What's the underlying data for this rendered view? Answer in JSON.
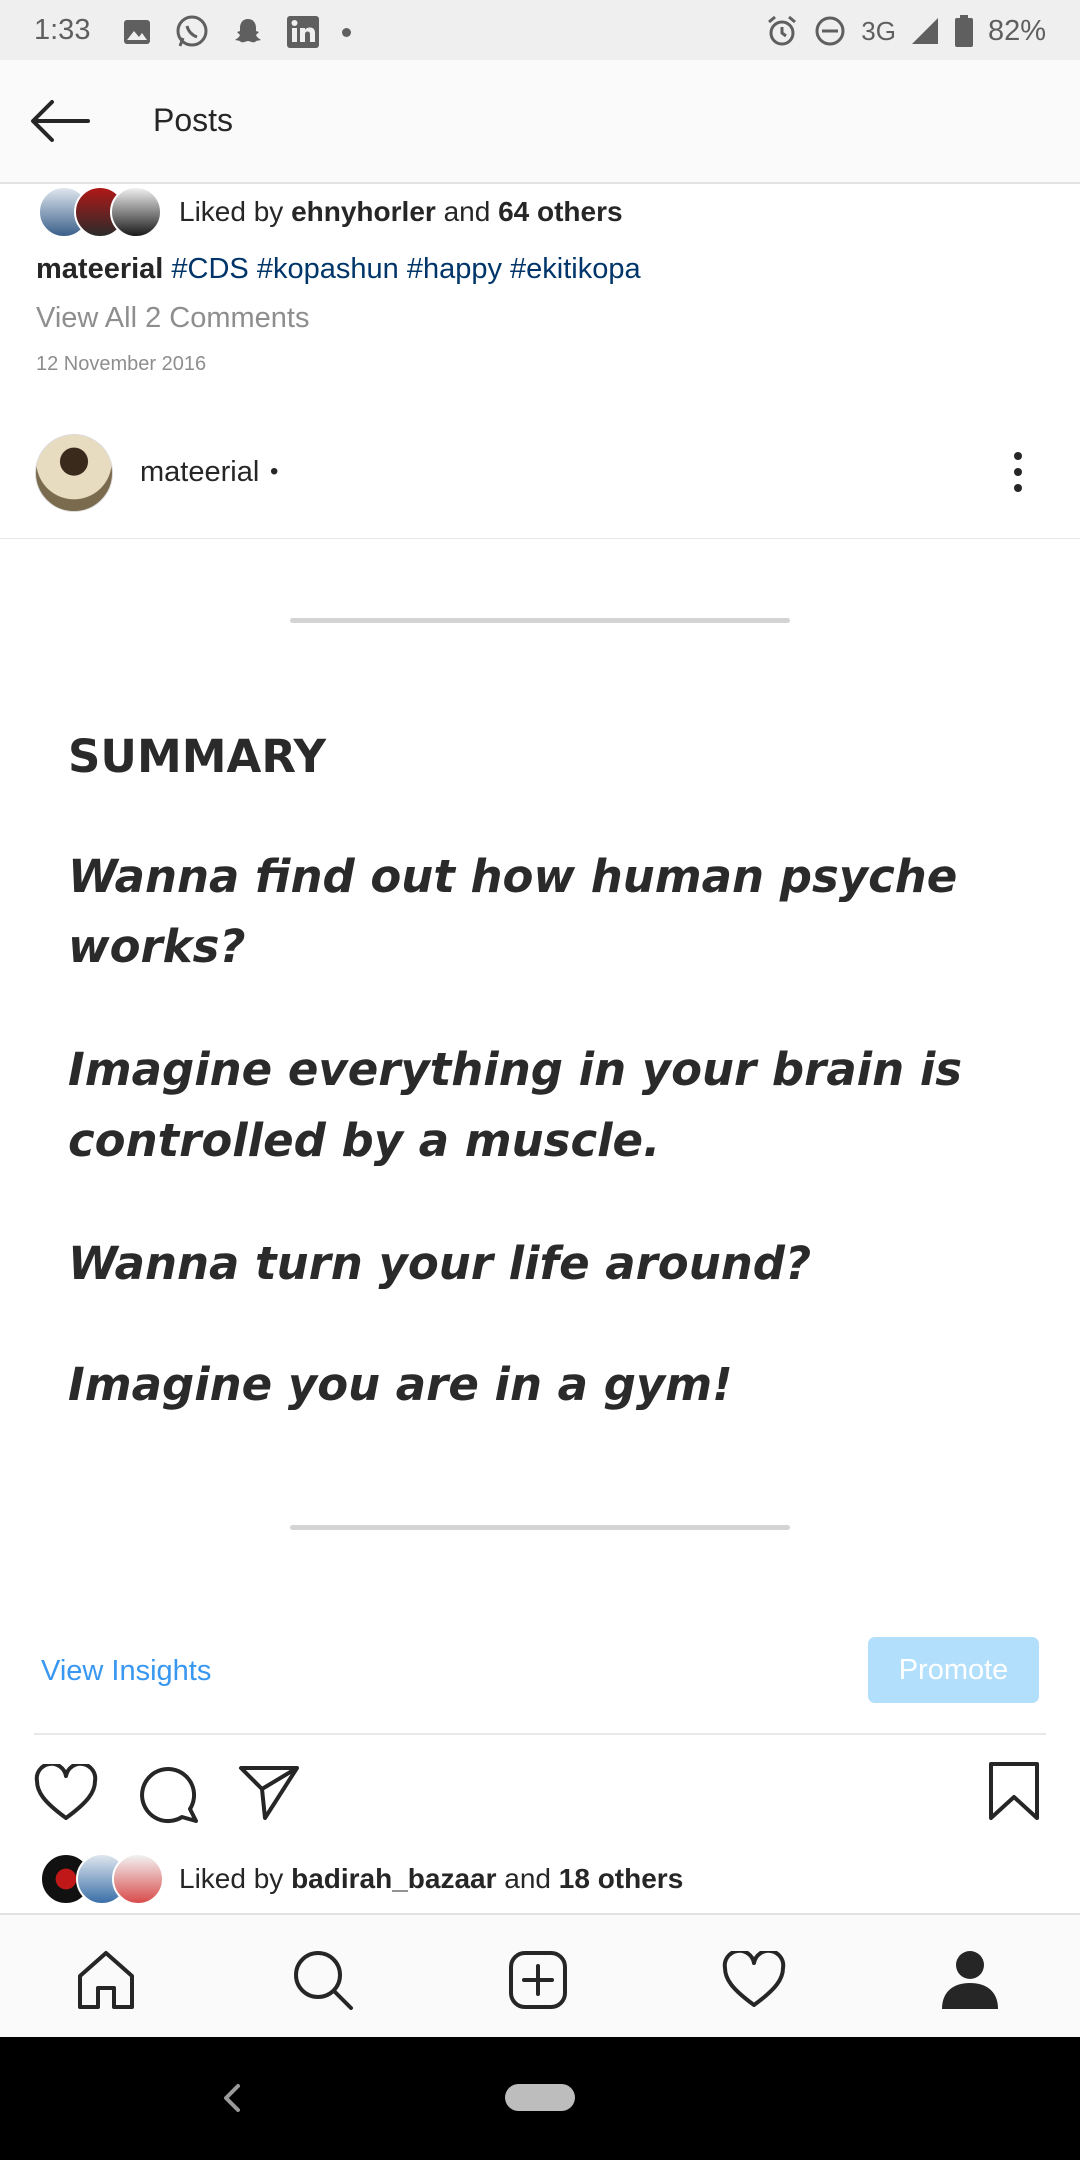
{
  "status_bar": {
    "time": "1:33",
    "network": "3G",
    "battery": "82%",
    "notification_icons": [
      "gallery-icon",
      "whatsapp-icon",
      "snapchat-icon",
      "linkedin-icon",
      "dot-icon"
    ],
    "status_icons": [
      "alarm-icon",
      "dnd-icon",
      "signal-icon",
      "battery-icon"
    ]
  },
  "top_nav": {
    "title": "Posts"
  },
  "previous_post": {
    "liked_prefix": "Liked by",
    "liked_user": "ehnyhorler",
    "liked_and": "and",
    "liked_others": "64 others",
    "caption_user": "mateerial",
    "hashtags": [
      "#CDS",
      "#kopashun",
      "#happy",
      "#ekitikopa"
    ],
    "comments_link": "View All 2 Comments",
    "date": "12 November 2016"
  },
  "post": {
    "username": "mateerial",
    "dot": "•",
    "image_text": {
      "heading": "SUMMARY",
      "lines": [
        [
          "Wanna find out how human psyche",
          "works?"
        ],
        [
          "Imagine everything in your brain is",
          "controlled by a muscle."
        ],
        [
          "Wanna turn your life around?"
        ],
        [
          "Imagine you are in a gym!"
        ]
      ]
    },
    "view_insights": "View Insights",
    "promote": "Promote",
    "liked_prefix": "Liked by",
    "liked_user": "badirah_bazaar",
    "liked_and": "and",
    "liked_others": "18 others"
  },
  "colors": {
    "link_blue": "#3897f0",
    "hashtag_blue": "#003569",
    "promote_bg": "#b2dffc",
    "muted": "#8e8e8e"
  }
}
